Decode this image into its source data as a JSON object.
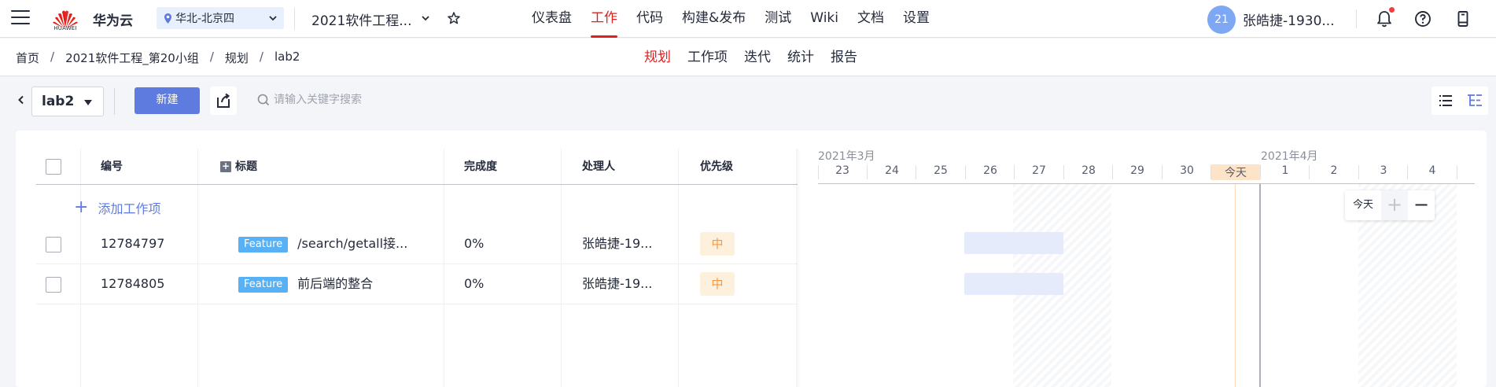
{
  "topbar": {
    "logo_text": "HUAWEI",
    "brand": "华为云",
    "region": "华北-北京四",
    "project": "2021软件工程...",
    "nav": [
      "仪表盘",
      "工作",
      "代码",
      "构建&发布",
      "测试",
      "Wiki",
      "文档",
      "设置"
    ],
    "nav_active": "工作",
    "avatar_text": "21",
    "username": "张皓捷-1930..."
  },
  "subbar": {
    "breadcrumb": [
      "首页",
      "2021软件工程_第20小组",
      "规划",
      "lab2"
    ],
    "separator": "/",
    "tabs": [
      "规划",
      "工作项",
      "迭代",
      "统计",
      "报告"
    ],
    "active_tab": "规划"
  },
  "toolbar": {
    "iteration": "lab2",
    "new_label": "新建",
    "search_placeholder": "请输入关键字搜索"
  },
  "table": {
    "headers": {
      "id": "编号",
      "title": "标题",
      "progress": "完成度",
      "assignee": "处理人",
      "priority": "优先级"
    },
    "add_label": "添加工作项",
    "rows": [
      {
        "id": "12784797",
        "type": "Feature",
        "title": "/search/getall接...",
        "progress": "0%",
        "assignee": "张皓捷-19...",
        "priority": "中"
      },
      {
        "id": "12784805",
        "type": "Feature",
        "title": "前后端的整合",
        "progress": "0%",
        "assignee": "张皓捷-19...",
        "priority": "中"
      }
    ]
  },
  "gantt": {
    "months": [
      "2021年3月",
      "2021年4月"
    ],
    "days": [
      "23",
      "24",
      "25",
      "26",
      "27",
      "28",
      "29",
      "30",
      "今天",
      "1",
      "2",
      "3",
      "4"
    ],
    "today_label": "今天",
    "today_button": "今天",
    "zoom_in": "+",
    "zoom_out": "−"
  },
  "colors": {
    "accent": "#e02020",
    "primary": "#5e7ce0",
    "feature_tag": "#58b1f5",
    "priority_bg": "#fdf0dc",
    "priority_text": "#fa9841"
  }
}
